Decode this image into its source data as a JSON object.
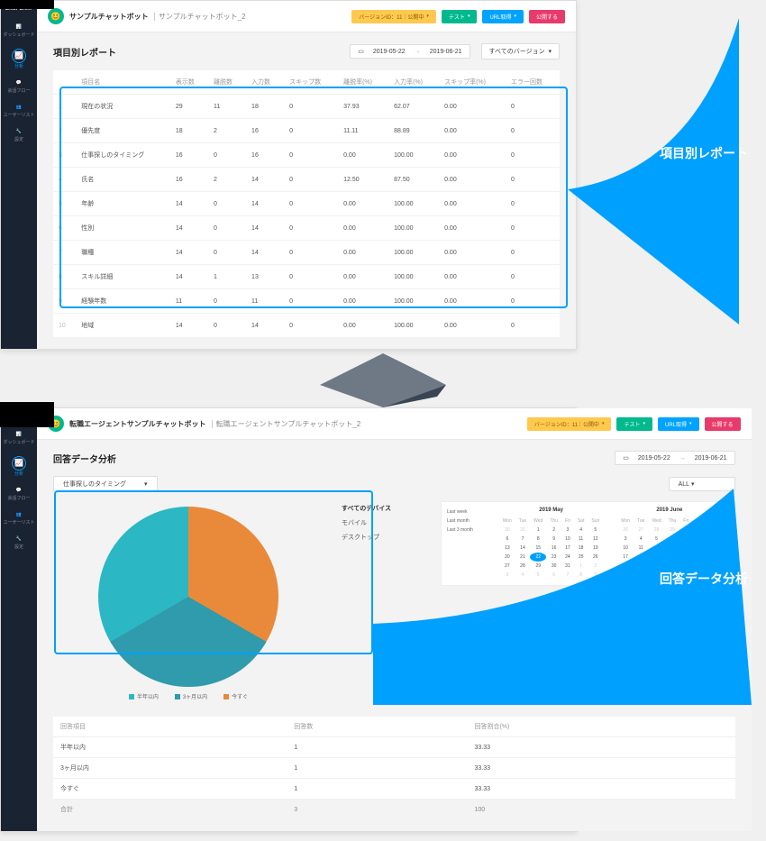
{
  "brand": "LAMPCHAT",
  "sidebar": {
    "items": [
      {
        "label": "ダッシュボード"
      },
      {
        "label": "分析"
      },
      {
        "label": "会話フロー"
      },
      {
        "label": "ユーザーリスト"
      },
      {
        "label": "設定"
      }
    ]
  },
  "topbar": {
    "bot_title_1": "サンプルチャットボット",
    "bot_subtitle_1": "サンプルチャットボット_2",
    "bot_title_2": "転職エージェントサンプルチャットボット",
    "bot_subtitle_2": "転職エージェントサンプルチャットボット_2",
    "buttons": {
      "version": "バージョンID：11｜公開中",
      "test": "テスト",
      "url": "URL取得",
      "publish": "公開する"
    }
  },
  "report": {
    "title": "項目別レポート",
    "date_from": "2019-05-22",
    "date_to": "2019-06-21",
    "version_select": "すべてのバージョン",
    "columns": [
      "",
      "項目名",
      "表示数",
      "離脱数",
      "入力数",
      "スキップ数",
      "離脱率(%)",
      "入力率(%)",
      "スキップ率(%)",
      "エラー回数"
    ],
    "rows": [
      [
        "1",
        "現在の状況",
        "29",
        "11",
        "18",
        "0",
        "37.93",
        "62.07",
        "0.00",
        "0"
      ],
      [
        "2",
        "優先度",
        "18",
        "2",
        "16",
        "0",
        "11.11",
        "88.89",
        "0.00",
        "0"
      ],
      [
        "3",
        "仕事探しのタイミング",
        "16",
        "0",
        "16",
        "0",
        "0.00",
        "100.00",
        "0.00",
        "0"
      ],
      [
        "4",
        "氏名",
        "16",
        "2",
        "14",
        "0",
        "12.50",
        "87.50",
        "0.00",
        "0"
      ],
      [
        "5",
        "年齢",
        "14",
        "0",
        "14",
        "0",
        "0.00",
        "100.00",
        "0.00",
        "0"
      ],
      [
        "6",
        "性別",
        "14",
        "0",
        "14",
        "0",
        "0.00",
        "100.00",
        "0.00",
        "0"
      ],
      [
        "7",
        "職種",
        "14",
        "0",
        "14",
        "0",
        "0.00",
        "100.00",
        "0.00",
        "0"
      ],
      [
        "8",
        "スキル詳細",
        "14",
        "1",
        "13",
        "0",
        "0.00",
        "100.00",
        "0.00",
        "0"
      ],
      [
        "9",
        "経験年数",
        "11",
        "0",
        "11",
        "0",
        "0.00",
        "100.00",
        "0.00",
        "0"
      ],
      [
        "10",
        "地域",
        "14",
        "0",
        "14",
        "0",
        "0.00",
        "100.00",
        "0.00",
        "0"
      ]
    ]
  },
  "analysis": {
    "title": "回答データ分析",
    "date_from": "2019-05-22",
    "date_to": "2019-06-21",
    "question_select": "仕事探しのタイミング",
    "all_filter": "ALL",
    "device_filters": [
      "すべてのデバイス",
      "モバイル",
      "デスクトップ"
    ],
    "presets": [
      "Last week",
      "Last month",
      "Last 3 month"
    ],
    "cal1_title": "2019 May",
    "cal2_title": "2019 June",
    "dow": [
      "Mon",
      "Tue",
      "Wed",
      "Thu",
      "Fri",
      "Sat",
      "Sun"
    ],
    "legend": [
      "半年以内",
      "3ヶ月以内",
      "今すぐ"
    ],
    "sum_columns": [
      "回答項目",
      "回答数",
      "回答割合(%)"
    ],
    "sum_rows": [
      [
        "半年以内",
        "1",
        "33.33"
      ],
      [
        "3ヶ月以内",
        "1",
        "33.33"
      ],
      [
        "今すぐ",
        "1",
        "33.33"
      ]
    ],
    "sum_total": [
      "合計",
      "3",
      "100"
    ]
  },
  "annotations": {
    "a1": "項目別レポート",
    "a2": "回答データ分析"
  },
  "chart_data": {
    "type": "pie",
    "title": "回答データ分析 — 仕事探しのタイミング",
    "categories": [
      "半年以内",
      "3ヶ月以内",
      "今すぐ"
    ],
    "values": [
      33.33,
      33.33,
      33.33
    ],
    "colors": [
      "#2bb8c4",
      "#2f9bac",
      "#e98a3a"
    ]
  }
}
